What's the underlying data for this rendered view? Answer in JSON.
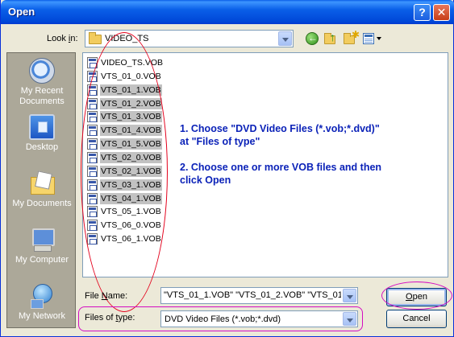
{
  "window": {
    "title": "Open",
    "help_glyph": "?",
    "close_glyph": "✕"
  },
  "lookin": {
    "label_prefix": "Look ",
    "label_accel": "i",
    "label_suffix": "n:",
    "value": "VIDEO_TS"
  },
  "toolbar": {
    "icons": [
      "back-icon",
      "up-folder-icon",
      "new-folder-icon",
      "views-menu-icon"
    ]
  },
  "places": [
    {
      "label": "My Recent Documents",
      "icon": "recent-documents-icon"
    },
    {
      "label": "Desktop",
      "icon": "desktop-icon"
    },
    {
      "label": "My Documents",
      "icon": "my-documents-icon"
    },
    {
      "label": "My Computer",
      "icon": "my-computer-icon"
    },
    {
      "label": "My Network",
      "icon": "my-network-icon"
    }
  ],
  "files": [
    {
      "name": "VIDEO_TS.VOB",
      "selected": false
    },
    {
      "name": "VTS_01_0.VOB",
      "selected": false
    },
    {
      "name": "VTS_01_1.VOB",
      "selected": true
    },
    {
      "name": "VTS_01_2.VOB",
      "selected": true
    },
    {
      "name": "VTS_01_3.VOB",
      "selected": true
    },
    {
      "name": "VTS_01_4.VOB",
      "selected": true
    },
    {
      "name": "VTS_01_5.VOB",
      "selected": true
    },
    {
      "name": "VTS_02_0.VOB",
      "selected": true
    },
    {
      "name": "VTS_02_1.VOB",
      "selected": true
    },
    {
      "name": "VTS_03_1.VOB",
      "selected": true
    },
    {
      "name": "VTS_04_1.VOB",
      "selected": true
    },
    {
      "name": "VTS_05_1.VOB",
      "selected": false
    },
    {
      "name": "VTS_06_0.VOB",
      "selected": false
    },
    {
      "name": "VTS_06_1.VOB",
      "selected": false
    }
  ],
  "annotation": {
    "step1_line1": "1. Choose \"DVD Video Files (*.vob;*.dvd)\"",
    "step1_line2": "at \"Files of type\"",
    "step2_line1": "2. Choose one or more VOB files and then",
    "step2_line2": "click Open"
  },
  "filename": {
    "label_accel": "N",
    "label_prefix": "File ",
    "label_suffix": "ame:",
    "value": "\"VTS_01_1.VOB\" \"VTS_01_2.VOB\" \"VTS_01_"
  },
  "filetype": {
    "label_prefix": "Files of ",
    "label_accel": "t",
    "label_suffix": "ype:",
    "value": "DVD Video Files (*.vob;*.dvd)"
  },
  "buttons": {
    "open_accel": "O",
    "open_rest": "pen",
    "cancel": "Cancel"
  },
  "colors": {
    "title_bar": "#0a5fe8",
    "annotation": "#0b22b8",
    "red_oval": "#e3001b",
    "magenta_highlight": "#d40bc1",
    "selection": "#c2c2c2"
  }
}
